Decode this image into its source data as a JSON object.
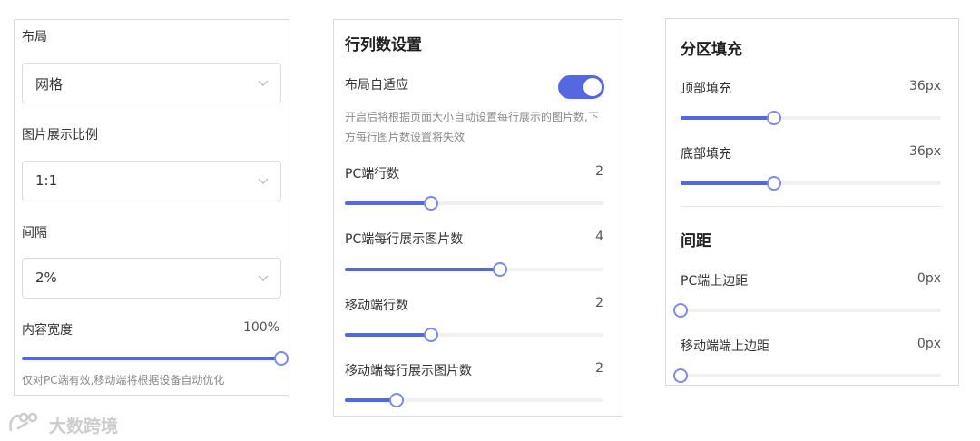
{
  "layout_panel": {
    "layout_label": "布局",
    "layout_value": "网格",
    "ratio_label": "图片展示比例",
    "ratio_value": "1:1",
    "gap_label": "间隔",
    "gap_value": "2%",
    "width_label": "内容宽度",
    "width_value": "100%",
    "width_level": 1.0,
    "width_hint": "仅对PC端有效,移动端将根据设备自动优化"
  },
  "rows_panel": {
    "title": "行列数设置",
    "adaptive_label": "布局自适应",
    "adaptive_on": true,
    "adaptive_hint": "开启后将根据页面大小自动设置每行展示的图片数,下方每行图片数设置将失效",
    "sliders": [
      {
        "label": "PC端行数",
        "value": "2",
        "level": 0.333
      },
      {
        "label": "PC端每行展示图片数",
        "value": "4",
        "level": 0.6
      },
      {
        "label": "移动端行数",
        "value": "2",
        "level": 0.333
      },
      {
        "label": "移动端每行展示图片数",
        "value": "2",
        "level": 0.2
      }
    ]
  },
  "padding_panel": {
    "fill_title": "分区填充",
    "top_label": "顶部填充",
    "top_value": "36px",
    "top_level": 0.36,
    "bottom_label": "底部填充",
    "bottom_value": "36px",
    "bottom_level": 0.36,
    "spacing_title": "间距",
    "pc_margin_label": "PC端上边距",
    "pc_margin_value": "0px",
    "pc_margin_level": 0,
    "mobile_margin_label": "移动端端上边距",
    "mobile_margin_value": "0px",
    "mobile_margin_level": 0
  },
  "watermark": {
    "text": "大数跨境"
  },
  "colors": {
    "accent": "#5468e0",
    "thumb_border": "#7b8bea",
    "track": "#f0f0f0"
  }
}
